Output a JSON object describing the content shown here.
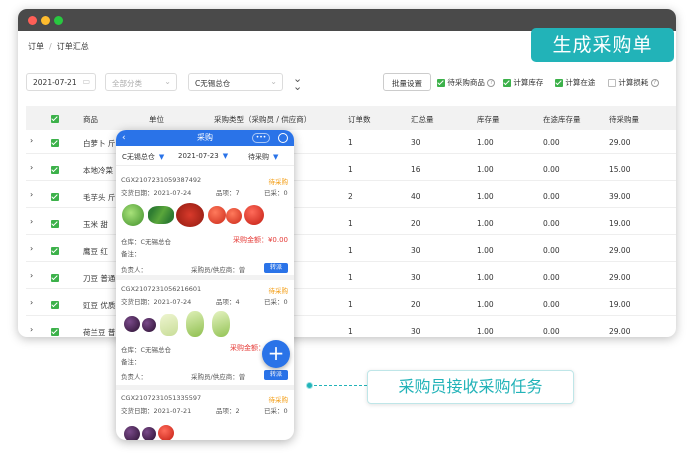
{
  "breadcrumb": {
    "first": "订单",
    "separator": "/",
    "current": "订单汇总"
  },
  "filters": {
    "date": "2021-07-21",
    "category_placeholder": "全部分类",
    "warehouse": "C无锡总仓",
    "batch_button": "批量设置",
    "options": [
      {
        "label": "待采购商品",
        "checked": true,
        "help": true
      },
      {
        "label": "计算库存",
        "checked": true,
        "help": false
      },
      {
        "label": "计算在途",
        "checked": true,
        "help": false
      },
      {
        "label": "计算损耗",
        "checked": false,
        "help": true
      }
    ]
  },
  "table": {
    "headers": [
      "商品",
      "单位",
      "采购类型（采购员 / 供应商）",
      "订单数",
      "汇总量",
      "库存量",
      "在途库存量",
      "待采购量"
    ],
    "rows": [
      {
        "product": "白萝卜 斤",
        "orders": "1",
        "total": "30",
        "stock": "1.00",
        "transit": "0.00",
        "pending": "29.00"
      },
      {
        "product": "本地冷菜",
        "orders": "1",
        "total": "16",
        "stock": "1.00",
        "transit": "0.00",
        "pending": "15.00"
      },
      {
        "product": "毛芋头 斤",
        "orders": "2",
        "total": "40",
        "stock": "1.00",
        "transit": "0.00",
        "pending": "39.00"
      },
      {
        "product": "玉米 甜",
        "orders": "1",
        "total": "20",
        "stock": "1.00",
        "transit": "0.00",
        "pending": "19.00"
      },
      {
        "product": "鹰豆 红",
        "orders": "1",
        "total": "30",
        "stock": "1.00",
        "transit": "0.00",
        "pending": "29.00"
      },
      {
        "product": "刀豆 普通",
        "orders": "1",
        "total": "30",
        "stock": "1.00",
        "transit": "0.00",
        "pending": "29.00"
      },
      {
        "product": "豇豆 优质",
        "orders": "1",
        "total": "20",
        "stock": "1.00",
        "transit": "0.00",
        "pending": "19.00"
      },
      {
        "product": "荷兰豆 普",
        "orders": "1",
        "total": "30",
        "stock": "1.00",
        "transit": "0.00",
        "pending": "29.00"
      }
    ]
  },
  "badge": "生成采购单",
  "task_label": "采购员接收采购任务",
  "phone": {
    "title": "采购",
    "capsule": "•••",
    "filter_warehouse": "C无锡总仓",
    "filter_date": "2021-07-23",
    "filter_status": "待采购",
    "cards": [
      {
        "id": "CGX2107231059387492",
        "status": "待采购",
        "date_label": "交货日期：",
        "date": "2021-07-24",
        "kind_label": "品项：",
        "kind": "7",
        "bought_label": "已采：",
        "bought": "0",
        "warehouse": "仓库：C无锡总仓",
        "amount_label": "采购金额：",
        "amount": "¥0.00",
        "note": "备注：",
        "owner": "负责人：",
        "buyer": "采购员/供应商：曾",
        "action": "转派"
      },
      {
        "id": "CGX2107231056216601",
        "status": "待采购",
        "date_label": "交货日期：",
        "date": "2021-07-24",
        "kind_label": "品项：",
        "kind": "4",
        "bought_label": "已采：",
        "bought": "0",
        "warehouse": "仓库：C无锡总仓",
        "amount_label": "采购金额：",
        "amount": "",
        "note": "备注：",
        "owner": "负责人：",
        "buyer": "采购员/供应商：曾",
        "action": "转派"
      },
      {
        "id": "CGX2107231051335597",
        "status": "待采购",
        "date_label": "交货日期：",
        "date": "2021-07-21",
        "kind_label": "品项：",
        "kind": "2",
        "bought_label": "已采：",
        "bought": "0"
      }
    ]
  },
  "colors": {
    "accent": "#22b3b8",
    "primary": "#2a73e8",
    "check": "#3cb14a",
    "status": "#f39c12",
    "amount": "#e53935"
  }
}
